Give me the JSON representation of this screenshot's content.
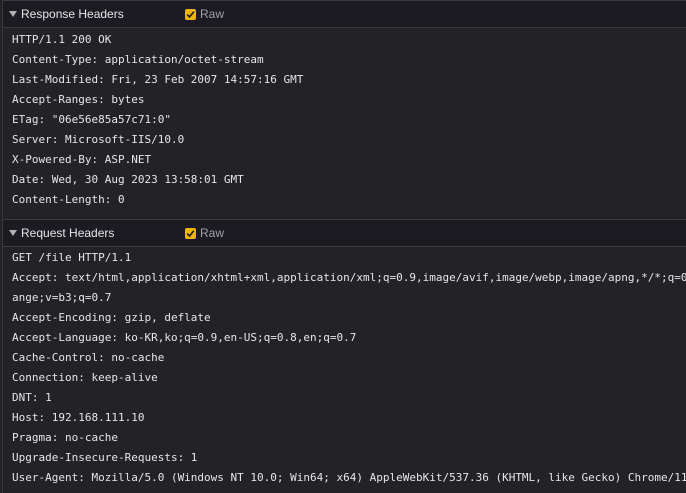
{
  "response": {
    "title": "Response Headers",
    "raw_label": "Raw",
    "raw_checked": true,
    "lines": [
      "HTTP/1.1 200 OK",
      "Content-Type: application/octet-stream",
      "Last-Modified: Fri, 23 Feb 2007 14:57:16 GMT",
      "Accept-Ranges: bytes",
      "ETag: \"06e56e85a57c71:0\"",
      "Server: Microsoft-IIS/10.0",
      "X-Powered-By: ASP.NET",
      "Date: Wed, 30 Aug 2023 13:58:01 GMT",
      "Content-Length: 0"
    ]
  },
  "request": {
    "title": "Request Headers",
    "raw_label": "Raw",
    "raw_checked": true,
    "lines": [
      "GET /file HTTP/1.1",
      "Accept: text/html,application/xhtml+xml,application/xml;q=0.9,image/avif,image/webp,image/apng,*/*;q=0",
      "ange;v=b3;q=0.7",
      "Accept-Encoding: gzip, deflate",
      "Accept-Language: ko-KR,ko;q=0.9,en-US;q=0.8,en;q=0.7",
      "Cache-Control: no-cache",
      "Connection: keep-alive",
      "DNT: 1",
      "Host: 192.168.111.10",
      "Pragma: no-cache",
      "Upgrade-Insecure-Requests: 1",
      "User-Agent: Mozilla/5.0 (Windows NT 10.0; Win64; x64) AppleWebKit/537.36 (KHTML, like Gecko) Chrome/11("
    ]
  },
  "colors": {
    "checkbox_accent": "#f0b400",
    "background": "#232327",
    "header_background": "#1c1b22"
  }
}
